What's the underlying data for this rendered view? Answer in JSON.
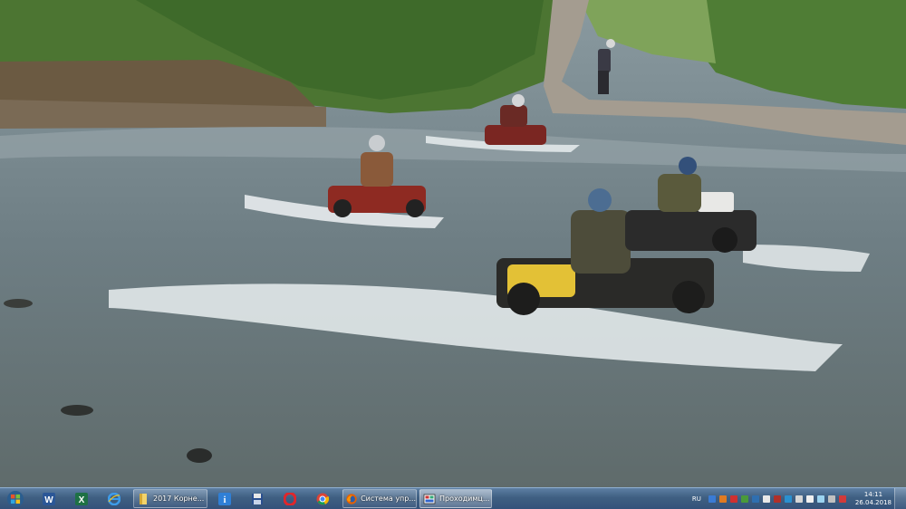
{
  "taskbar": {
    "windows": [
      {
        "label": "2017 Корне...",
        "icon": "folder-icon"
      },
      {
        "label": "Система упр...",
        "icon": "firefox-icon"
      },
      {
        "label": "Проходимц...",
        "icon": "image-viewer-icon"
      }
    ],
    "language": "RU",
    "time": "14:11",
    "date": "26.04.2018"
  },
  "colors": {
    "taskbar": "#3f5f82",
    "river": "#6f7f80",
    "foliage": "#4f7a35"
  }
}
